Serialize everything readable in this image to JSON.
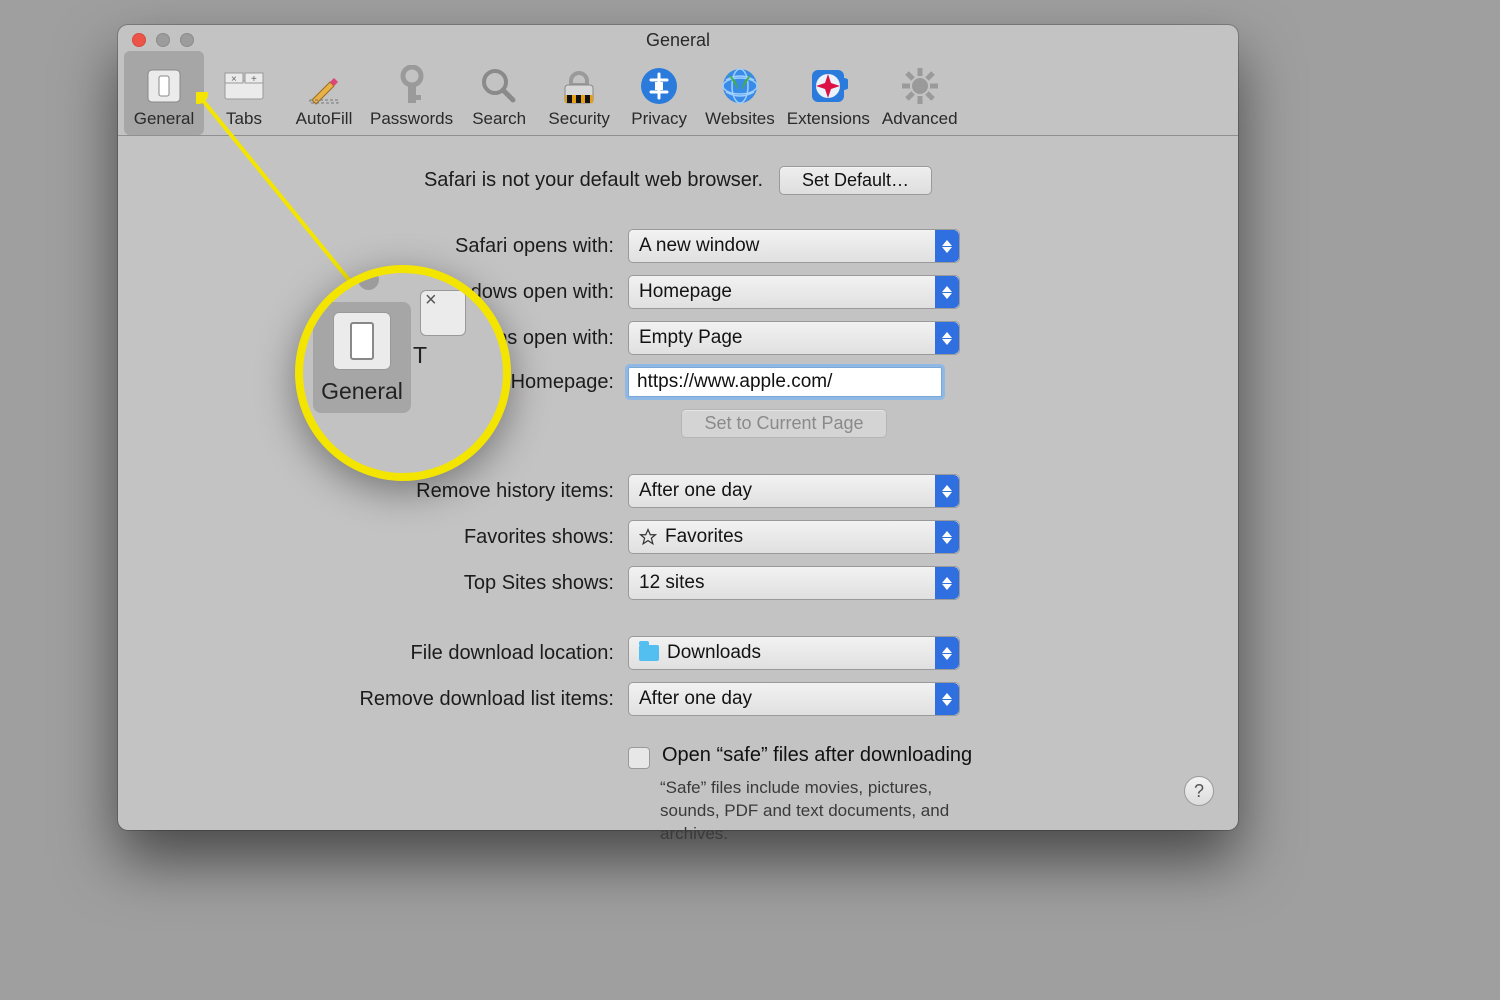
{
  "window": {
    "title": "General"
  },
  "toolbar": {
    "tabs": [
      {
        "name": "general",
        "label": "General"
      },
      {
        "name": "tabs",
        "label": "Tabs"
      },
      {
        "name": "autofill",
        "label": "AutoFill"
      },
      {
        "name": "passwords",
        "label": "Passwords"
      },
      {
        "name": "search",
        "label": "Search"
      },
      {
        "name": "security",
        "label": "Security"
      },
      {
        "name": "privacy",
        "label": "Privacy"
      },
      {
        "name": "websites",
        "label": "Websites"
      },
      {
        "name": "extensions",
        "label": "Extensions"
      },
      {
        "name": "advanced",
        "label": "Advanced"
      }
    ],
    "selected": "general"
  },
  "defaultBrowser": {
    "message": "Safari is not your default web browser.",
    "button": "Set Default…"
  },
  "form": {
    "opensWith": {
      "label": "Safari opens with:",
      "value": "A new window"
    },
    "windowsOpen": {
      "label": "New windows open with:",
      "value": "Homepage"
    },
    "tabsOpen": {
      "label": "New tabs open with:",
      "value": "Empty Page"
    },
    "homepage": {
      "label": "Homepage:",
      "value": "https://www.apple.com/"
    },
    "setCurrent": {
      "label": "Set to Current Page"
    },
    "removeHistory": {
      "label": "Remove history items:",
      "value": "After one day"
    },
    "favorites": {
      "label": "Favorites shows:",
      "value": "Favorites"
    },
    "topSites": {
      "label": "Top Sites shows:",
      "value": "12 sites"
    },
    "downloadLoc": {
      "label": "File download location:",
      "value": "Downloads"
    },
    "removeDownloads": {
      "label": "Remove download list items:",
      "value": "After one day"
    },
    "safeFiles": {
      "label": "Open “safe” files after downloading",
      "help": "“Safe” files include movies, pictures, sounds, PDF and text documents, and archives."
    }
  },
  "helpButton": "?",
  "callout": {
    "tabLabel": "General",
    "sideLabel": "T"
  }
}
